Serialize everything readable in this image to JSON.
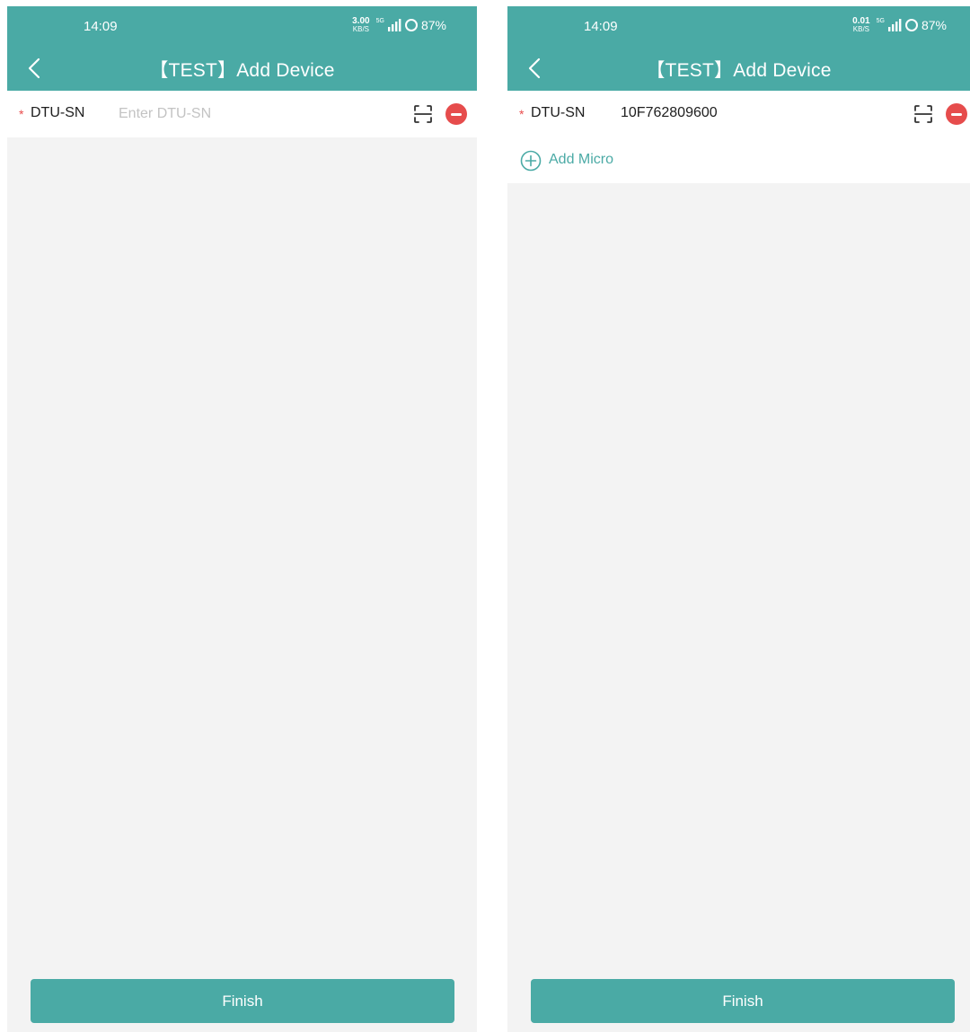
{
  "colors": {
    "accent": "#4aaaa5",
    "danger": "#e64c4c",
    "background": "#f3f3f3"
  },
  "screens": [
    {
      "status": {
        "time": "14:09",
        "speed_value": "3.00",
        "speed_unit": "KB/S",
        "signal_label": "5G",
        "battery": "87%"
      },
      "header": {
        "title": "【TEST】Add Device",
        "back_icon": "chevron-left-icon"
      },
      "dtu": {
        "label": "DTU-SN",
        "required_mark": "*",
        "placeholder": "Enter DTU-SN",
        "value": "",
        "scan_icon": "scan-icon",
        "remove_icon": "remove-circle-icon"
      },
      "finish_label": "Finish"
    },
    {
      "status": {
        "time": "14:09",
        "speed_value": "0.01",
        "speed_unit": "KB/S",
        "signal_label": "5G",
        "battery": "87%"
      },
      "header": {
        "title": "【TEST】Add Device",
        "back_icon": "chevron-left-icon"
      },
      "dtu": {
        "label": "DTU-SN",
        "required_mark": "*",
        "value": "10F762809600",
        "scan_icon": "scan-icon",
        "remove_icon": "remove-circle-icon"
      },
      "add_micro": {
        "label": "Add Micro",
        "icon": "plus-circle-icon"
      },
      "finish_label": "Finish"
    }
  ]
}
